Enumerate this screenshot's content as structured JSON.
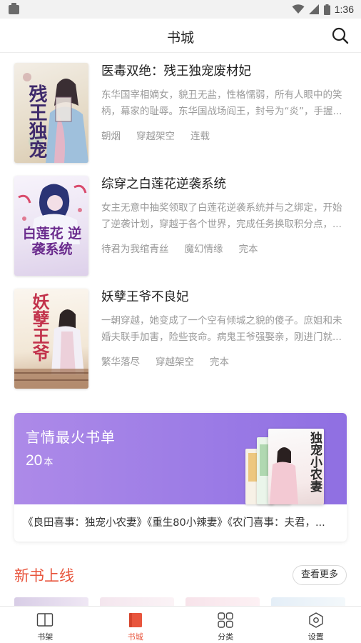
{
  "status_bar": {
    "time": "1:36"
  },
  "header": {
    "title": "书城"
  },
  "books": [
    {
      "title": "医毒双绝：残王独宠废材妃",
      "description": "东华国宰相嫡女，貌丑无盐，性格懦弱，所有人眼中的笑柄，幕家的耻辱。东华国战场阎王，封号为“炎”，手握...",
      "author": "朝烟",
      "category": "穿越架空",
      "status": "连载",
      "cover_text": "残王独宠"
    },
    {
      "title": "综穿之白莲花逆袭系统",
      "description": "女主无意中抽奖领取了白莲花逆袭系统并与之绑定，开始了逆袭计划，穿越于各个世界，完成任务换取积分点，...",
      "author": "待君为我绾青丝",
      "category": "魔幻情缘",
      "status": "完本",
      "cover_text": "白莲花 逆袭系统"
    },
    {
      "title": "妖孽王爷不良妃",
      "description": "一朝穿越，她变成了一个空有倾城之貌的傻子。庶姐和未婚夫联手加害，险些丧命。病鬼王爷强娶亲，刚进门就...",
      "author": "繁华落尽",
      "category": "穿越架空",
      "status": "完本",
      "cover_text": "妖孽王爷"
    }
  ],
  "promo": {
    "title": "言情最火书单",
    "count": "20",
    "count_unit": "本",
    "list_text": "《良田喜事：独宠小农妻》《重生80小辣妻》《农门喜事：夫君，...",
    "cover_text": "独宠小农妻"
  },
  "new_books": {
    "title": "新书上线",
    "more_label": "查看更多"
  },
  "bottom_nav": [
    {
      "label": "书架",
      "icon": "book-icon",
      "active": false
    },
    {
      "label": "书城",
      "icon": "bookstore-icon",
      "active": true
    },
    {
      "label": "分类",
      "icon": "category-icon",
      "active": false
    },
    {
      "label": "设置",
      "icon": "settings-icon",
      "active": false
    }
  ],
  "colors": {
    "accent": "#e8553d",
    "promo_gradient_start": "#ad8ae8",
    "promo_gradient_end": "#8f6fe2"
  }
}
